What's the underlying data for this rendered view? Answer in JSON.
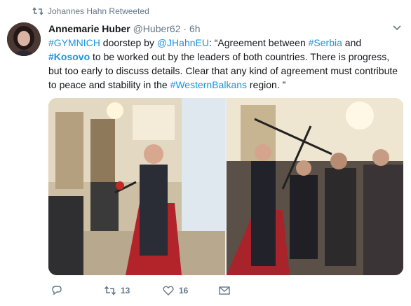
{
  "retweet_context": {
    "label": "Johannes Hahn Retweeted"
  },
  "author": {
    "name": "Annemarie Huber",
    "handle": "@Huber62",
    "separator": "·",
    "time": "6h"
  },
  "tweet": {
    "seg1": "#GYMNICH",
    "seg2": " doorstep by ",
    "seg3": "@JHahnEU",
    "seg4": ": “Agreement between ",
    "seg5": "#Serbia",
    "seg6": " and ",
    "seg7": "#Kosovo",
    "seg8": " to be worked out by the leaders of both countries. There is progress, but too early to discuss details. Clear that any kind of agreement must contribute to peace and stability in the ",
    "seg9": "#WesternBalkans",
    "seg10": " region. ”"
  },
  "actions": {
    "reply_count": "",
    "retweet_count": "13",
    "like_count": "16"
  },
  "colors": {
    "link": "#1b95e0",
    "muted": "#657786",
    "text": "#14171a"
  },
  "icons": [
    "retweet-icon",
    "chevron-down-icon",
    "reply-icon",
    "retweet-icon",
    "heart-icon",
    "direct-message-icon"
  ]
}
